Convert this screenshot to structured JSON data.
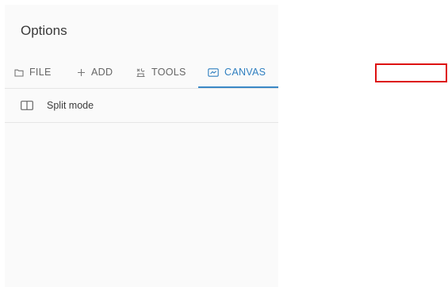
{
  "panel": {
    "title": "Options"
  },
  "tabs": [
    {
      "label": "FILE",
      "icon": "folder-icon",
      "active": false
    },
    {
      "label": "ADD",
      "icon": "plus-icon",
      "active": false
    },
    {
      "label": "TOOLS",
      "icon": "tools-icon",
      "active": false
    },
    {
      "label": "CANVAS",
      "icon": "canvas-icon",
      "active": true
    }
  ],
  "options": [
    {
      "label": "Split mode",
      "icon": "split-view-icon"
    }
  ],
  "colors": {
    "accent": "#2f7fc0",
    "highlight_box": "#dd1111"
  }
}
